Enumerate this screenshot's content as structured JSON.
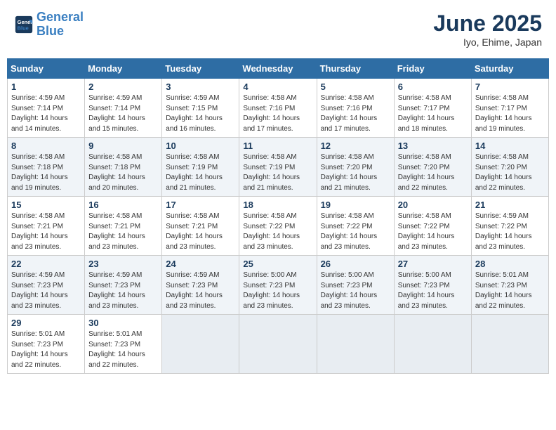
{
  "header": {
    "logo_line1": "General",
    "logo_line2": "Blue",
    "month_title": "June 2025",
    "location": "Iyo, Ehime, Japan"
  },
  "weekdays": [
    "Sunday",
    "Monday",
    "Tuesday",
    "Wednesday",
    "Thursday",
    "Friday",
    "Saturday"
  ],
  "weeks": [
    [
      {
        "day": "1",
        "rise": "4:59 AM",
        "set": "7:14 PM",
        "daylight": "14 hours and 14 minutes."
      },
      {
        "day": "2",
        "rise": "4:59 AM",
        "set": "7:14 PM",
        "daylight": "14 hours and 15 minutes."
      },
      {
        "day": "3",
        "rise": "4:59 AM",
        "set": "7:15 PM",
        "daylight": "14 hours and 16 minutes."
      },
      {
        "day": "4",
        "rise": "4:58 AM",
        "set": "7:16 PM",
        "daylight": "14 hours and 17 minutes."
      },
      {
        "day": "5",
        "rise": "4:58 AM",
        "set": "7:16 PM",
        "daylight": "14 hours and 17 minutes."
      },
      {
        "day": "6",
        "rise": "4:58 AM",
        "set": "7:17 PM",
        "daylight": "14 hours and 18 minutes."
      },
      {
        "day": "7",
        "rise": "4:58 AM",
        "set": "7:17 PM",
        "daylight": "14 hours and 19 minutes."
      }
    ],
    [
      {
        "day": "8",
        "rise": "4:58 AM",
        "set": "7:18 PM",
        "daylight": "14 hours and 19 minutes."
      },
      {
        "day": "9",
        "rise": "4:58 AM",
        "set": "7:18 PM",
        "daylight": "14 hours and 20 minutes."
      },
      {
        "day": "10",
        "rise": "4:58 AM",
        "set": "7:19 PM",
        "daylight": "14 hours and 21 minutes."
      },
      {
        "day": "11",
        "rise": "4:58 AM",
        "set": "7:19 PM",
        "daylight": "14 hours and 21 minutes."
      },
      {
        "day": "12",
        "rise": "4:58 AM",
        "set": "7:20 PM",
        "daylight": "14 hours and 21 minutes."
      },
      {
        "day": "13",
        "rise": "4:58 AM",
        "set": "7:20 PM",
        "daylight": "14 hours and 22 minutes."
      },
      {
        "day": "14",
        "rise": "4:58 AM",
        "set": "7:20 PM",
        "daylight": "14 hours and 22 minutes."
      }
    ],
    [
      {
        "day": "15",
        "rise": "4:58 AM",
        "set": "7:21 PM",
        "daylight": "14 hours and 23 minutes."
      },
      {
        "day": "16",
        "rise": "4:58 AM",
        "set": "7:21 PM",
        "daylight": "14 hours and 23 minutes."
      },
      {
        "day": "17",
        "rise": "4:58 AM",
        "set": "7:21 PM",
        "daylight": "14 hours and 23 minutes."
      },
      {
        "day": "18",
        "rise": "4:58 AM",
        "set": "7:22 PM",
        "daylight": "14 hours and 23 minutes."
      },
      {
        "day": "19",
        "rise": "4:58 AM",
        "set": "7:22 PM",
        "daylight": "14 hours and 23 minutes."
      },
      {
        "day": "20",
        "rise": "4:58 AM",
        "set": "7:22 PM",
        "daylight": "14 hours and 23 minutes."
      },
      {
        "day": "21",
        "rise": "4:59 AM",
        "set": "7:22 PM",
        "daylight": "14 hours and 23 minutes."
      }
    ],
    [
      {
        "day": "22",
        "rise": "4:59 AM",
        "set": "7:23 PM",
        "daylight": "14 hours and 23 minutes."
      },
      {
        "day": "23",
        "rise": "4:59 AM",
        "set": "7:23 PM",
        "daylight": "14 hours and 23 minutes."
      },
      {
        "day": "24",
        "rise": "4:59 AM",
        "set": "7:23 PM",
        "daylight": "14 hours and 23 minutes."
      },
      {
        "day": "25",
        "rise": "5:00 AM",
        "set": "7:23 PM",
        "daylight": "14 hours and 23 minutes."
      },
      {
        "day": "26",
        "rise": "5:00 AM",
        "set": "7:23 PM",
        "daylight": "14 hours and 23 minutes."
      },
      {
        "day": "27",
        "rise": "5:00 AM",
        "set": "7:23 PM",
        "daylight": "14 hours and 23 minutes."
      },
      {
        "day": "28",
        "rise": "5:01 AM",
        "set": "7:23 PM",
        "daylight": "14 hours and 22 minutes."
      }
    ],
    [
      {
        "day": "29",
        "rise": "5:01 AM",
        "set": "7:23 PM",
        "daylight": "14 hours and 22 minutes."
      },
      {
        "day": "30",
        "rise": "5:01 AM",
        "set": "7:23 PM",
        "daylight": "14 hours and 22 minutes."
      },
      null,
      null,
      null,
      null,
      null
    ]
  ],
  "labels": {
    "sunrise": "Sunrise:",
    "sunset": "Sunset:",
    "daylight": "Daylight:"
  }
}
